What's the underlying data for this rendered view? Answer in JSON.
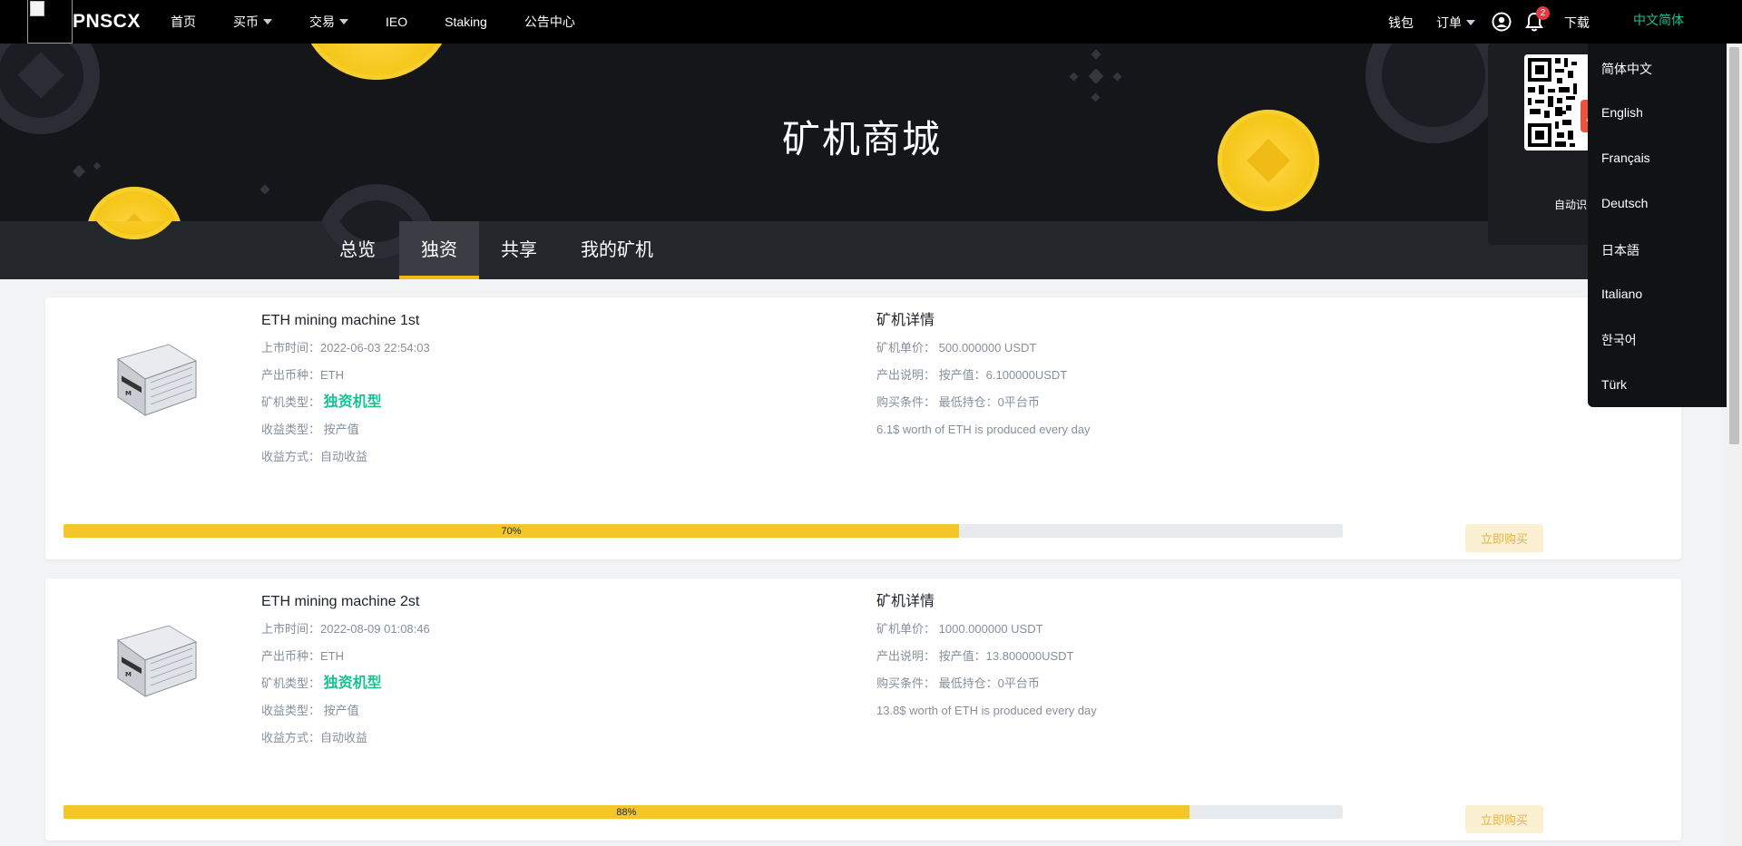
{
  "nav": {
    "brand": "PNSCX",
    "items": [
      {
        "label": "首页"
      },
      {
        "label": "买币",
        "dropdown": true
      },
      {
        "label": "交易",
        "dropdown": true
      },
      {
        "label": "IEO"
      },
      {
        "label": "Staking"
      },
      {
        "label": "公告中心"
      }
    ],
    "right": {
      "wallet": "钱包",
      "orders": "订单",
      "notification_count": "2",
      "download": "下载",
      "language": "中文简体"
    }
  },
  "banner": {
    "title": "矿机商城"
  },
  "tabs": [
    {
      "label": "总览",
      "active": false
    },
    {
      "label": "独资",
      "active": true
    },
    {
      "label": "共享",
      "active": false
    },
    {
      "label": "我的矿机",
      "active": false
    }
  ],
  "machines": [
    {
      "name": "ETH mining machine 1st",
      "listed_label": "上市时间：",
      "listed": "2022-06-03 22:54:03",
      "coin_label": "产出币种：",
      "coin": "ETH",
      "type_label": "矿机类型：",
      "type": "独资机型",
      "income_type_label": "收益类型：",
      "income_type": "按产值",
      "income_method_label": "收益方式：",
      "income_method": "自动收益",
      "details_title": "矿机详情",
      "price_label": "矿机单价：",
      "price": "500.000000 USDT",
      "output_label": "产出说明：",
      "output": "按产值：6.100000USDT",
      "condition_label": "购买条件：",
      "condition": "最低持仓：0平台币",
      "description": "6.1$ worth of ETH is produced every day",
      "progress": 70,
      "progress_label": "70%",
      "buy_label": "立即购买"
    },
    {
      "name": "ETH mining machine 2st",
      "listed_label": "上市时间：",
      "listed": "2022-08-09 01:08:46",
      "coin_label": "产出币种：",
      "coin": "ETH",
      "type_label": "矿机类型：",
      "type": "独资机型",
      "income_type_label": "收益类型：",
      "income_type": "按产值",
      "income_method_label": "收益方式：",
      "income_method": "自动收益",
      "details_title": "矿机详情",
      "price_label": "矿机单价：",
      "price": "1000.000000 USDT",
      "output_label": "产出说明：",
      "output": "按产值：13.800000USDT",
      "condition_label": "购买条件：",
      "condition": "最低持仓：0平台币",
      "description": "13.8$ worth of ETH is produced every day",
      "progress": 88,
      "progress_label": "88%",
      "buy_label": "立即购买"
    }
  ],
  "download_panel": {
    "caption": "自动识"
  },
  "language_menu": [
    "简体中文",
    "English",
    "Français",
    "Deutsch",
    "日本語",
    "Italiano",
    "한국어",
    "Türk"
  ],
  "colors": {
    "accent_yellow": "#f0b90b",
    "accent_green": "#1bbf95",
    "badge_red": "#e63946"
  }
}
